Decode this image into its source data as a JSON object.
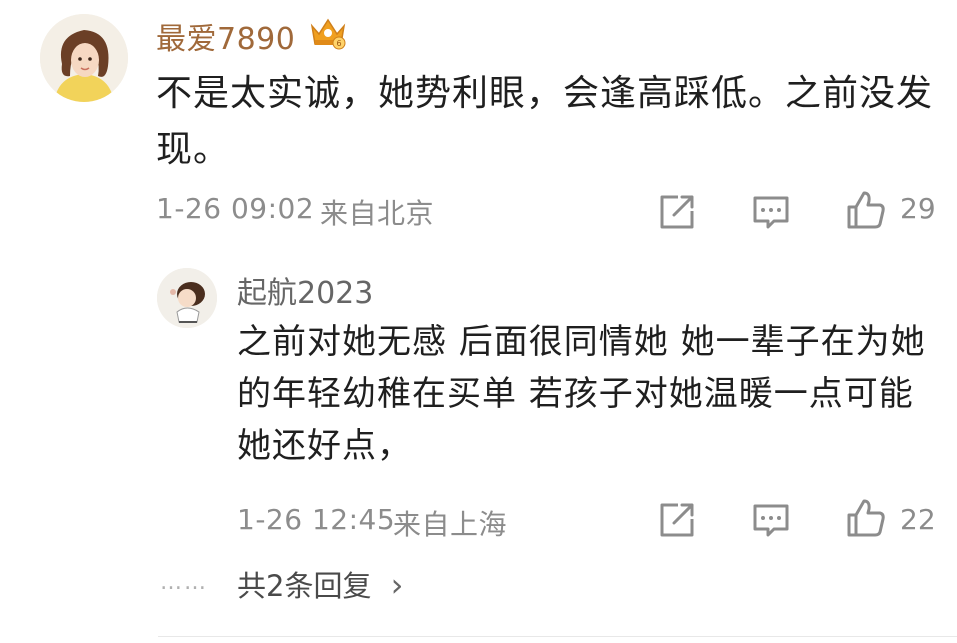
{
  "comment": {
    "username": "最爱7890",
    "badge_icon": "crown-vip-icon",
    "text": "不是太实诚，她势利眼，会逢高踩低。之前没发现。",
    "time": "1-26 09:02",
    "location": "来自北京",
    "likes": "29"
  },
  "reply": {
    "username": "起航2023",
    "text": "之前对她无感 后面很同情她 她一辈子在为她的年轻幼稚在买单 若孩子对她温暖一点可能她还好点，",
    "time": "1-26 12:45",
    "location": "来自上海",
    "likes": "22"
  },
  "more": {
    "dots": "……",
    "label": "共2条回复",
    "chevron": "›"
  },
  "colors": {
    "username": "#a0693a",
    "meta": "#8c8c8c",
    "text": "#1f1f1f"
  }
}
